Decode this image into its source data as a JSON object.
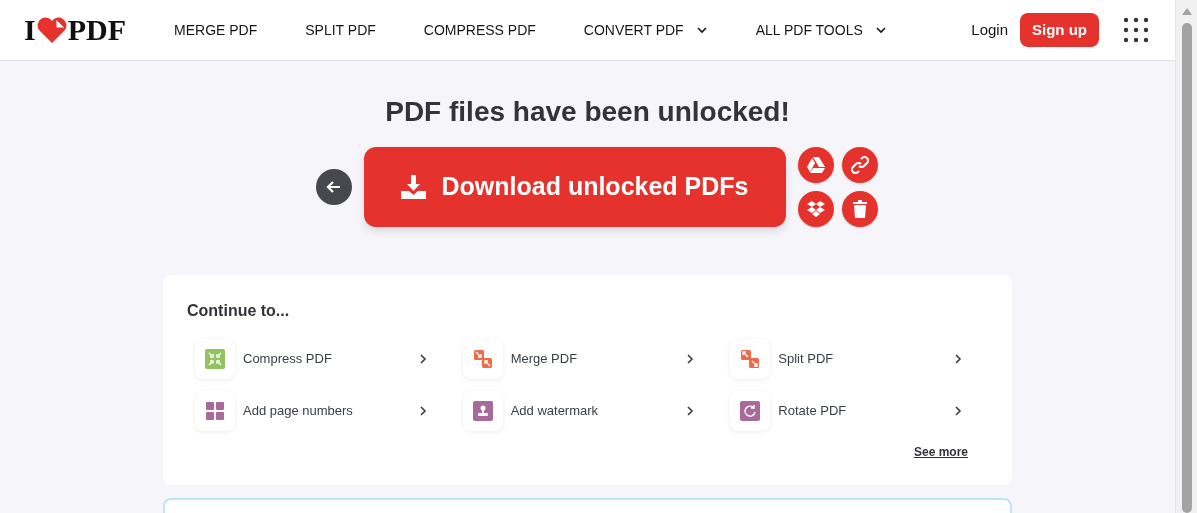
{
  "header": {
    "logo": {
      "left": "I",
      "right": "PDF"
    },
    "nav": [
      {
        "label": "MERGE PDF",
        "dropdown": false
      },
      {
        "label": "SPLIT PDF",
        "dropdown": false
      },
      {
        "label": "COMPRESS PDF",
        "dropdown": false
      },
      {
        "label": "CONVERT PDF",
        "dropdown": true
      },
      {
        "label": "ALL PDF TOOLS",
        "dropdown": true
      }
    ],
    "login": "Login",
    "signup": "Sign up"
  },
  "result": {
    "title": "PDF files have been unlocked!",
    "download": "Download unlocked PDFs"
  },
  "continue": {
    "heading": "Continue to...",
    "tools": [
      {
        "label": "Compress PDF",
        "kind": "compress",
        "color": "#93c35e"
      },
      {
        "label": "Merge PDF",
        "kind": "merge",
        "color": "#ee6a4b"
      },
      {
        "label": "Split PDF",
        "kind": "split",
        "color": "#ee6a4b"
      },
      {
        "label": "Add page numbers",
        "kind": "numbers",
        "color": "#a8699b"
      },
      {
        "label": "Add watermark",
        "kind": "watermark",
        "color": "#a8699b"
      },
      {
        "label": "Rotate PDF",
        "kind": "rotate",
        "color": "#a8699b"
      }
    ],
    "see_more": "See more"
  }
}
